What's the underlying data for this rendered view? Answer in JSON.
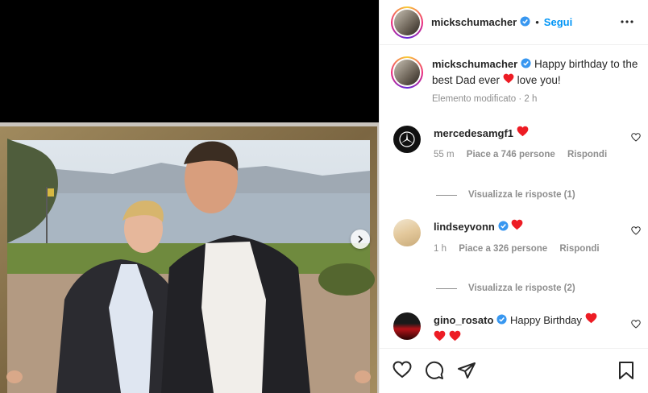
{
  "post": {
    "username": "mickschumacher",
    "follow_label": "Segui",
    "separator": "•"
  },
  "caption": {
    "username": "mickschumacher",
    "text": "Happy birthday to the best Dad ever",
    "text_after": "love you!",
    "meta": "Elemento modificato · 2 h"
  },
  "comments": [
    {
      "username": "mercedesamgf1",
      "text": "",
      "time": "55 m",
      "likes": "Piace a 746 persone",
      "reply": "Rispondi",
      "replies_label": "Visualizza le risposte (1)"
    },
    {
      "username": "lindseyvonn",
      "text": "",
      "time": "1 h",
      "likes": "Piace a 326 persone",
      "reply": "Rispondi",
      "replies_label": "Visualizza le risposte (2)"
    },
    {
      "username": "gino_rosato",
      "text": "Happy Birthday"
    }
  ],
  "colors": {
    "accent": "#0095f6",
    "heart": "#ed1c24",
    "verified": "#3897f0",
    "muted": "#8e8e8e"
  },
  "icons": [
    "more-icon",
    "verified-icon",
    "heart-icon",
    "comment-icon",
    "share-icon",
    "bookmark-icon",
    "chevron-right-icon"
  ]
}
